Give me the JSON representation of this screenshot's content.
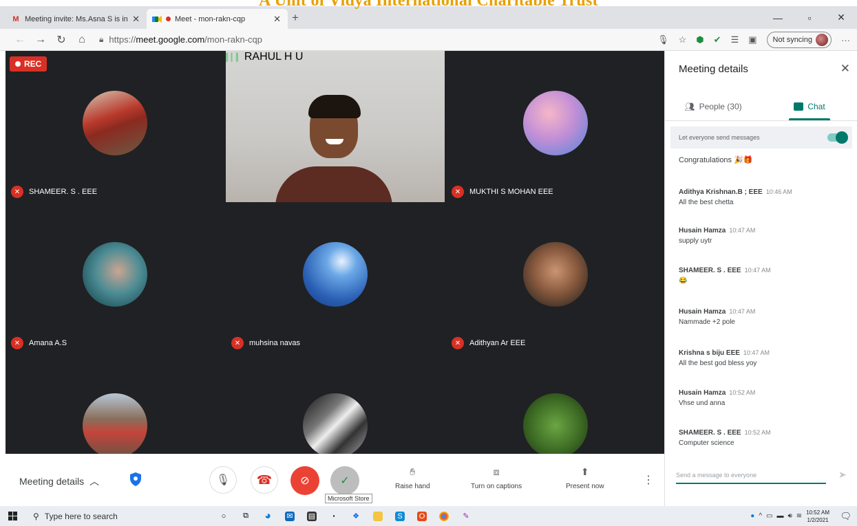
{
  "overlay_heading": "A Unit of Vidya International Charitable Trust",
  "browser": {
    "tabs": [
      {
        "title": "Meeting invite: Ms.Asna S is invi",
        "favicon": "gmail-icon",
        "active": false
      },
      {
        "title": "Meet - mon-rakn-cqp",
        "favicon": "meet-icon",
        "active": true,
        "recording": true
      }
    ],
    "url_prefix": "https://",
    "url_host": "meet.google.com",
    "url_path": "/mon-rakn-cqp",
    "sync_label": "Not syncing"
  },
  "meet": {
    "rec_label": "REC",
    "participants": [
      {
        "name": "SHAMEER. S . EEE",
        "muted": true,
        "avatar": "car-photo"
      },
      {
        "name": "RAHUL H U",
        "muted": false,
        "speaking": true,
        "video": true
      },
      {
        "name": "MUKTHI S MOHAN EEE",
        "muted": true,
        "avatar": "rose-photo"
      },
      {
        "name": "Amana A.S",
        "muted": true,
        "avatar": "girl-photo"
      },
      {
        "name": "muhsina navas",
        "muted": true,
        "avatar": "moon-sea-photo"
      },
      {
        "name": "Adithyan Ar EEE",
        "muted": true,
        "avatar": "actor-photo"
      },
      {
        "name": "",
        "muted": true,
        "avatar": "group-photo"
      },
      {
        "name": "",
        "muted": true,
        "avatar": "bw-photo"
      },
      {
        "name": "",
        "muted": true,
        "avatar": "leaf-photo"
      }
    ]
  },
  "controls": {
    "meeting_details": "Meeting details",
    "tooltip": "Microsoft Store",
    "raise_hand": "Raise hand",
    "captions": "Turn on captions",
    "present": "Present now"
  },
  "panel": {
    "title": "Meeting details",
    "people_tab": "People (30)",
    "chat_tab": "Chat",
    "everyone_label": "Let everyone send messages",
    "congrats": "Congratulations",
    "messages": [
      {
        "sender": "Adithya Krishnan.B ; EEE",
        "time": "10:46 AM",
        "text": "All the best chetta"
      },
      {
        "sender": "Husain Hamza",
        "time": "10:47 AM",
        "text": "supply uytr"
      },
      {
        "sender": "SHAMEER. S . EEE",
        "time": "10:47 AM",
        "text": "😂"
      },
      {
        "sender": "Husain Hamza",
        "time": "10:47 AM",
        "text": "Nammade +2 pole"
      },
      {
        "sender": "Krishna s biju EEE",
        "time": "10:47 AM",
        "text": "All the best god bless yoy"
      },
      {
        "sender": "Husain Hamza",
        "time": "10:52 AM",
        "text": "Vhse und anna"
      },
      {
        "sender": "SHAMEER. S . EEE",
        "time": "10:52 AM",
        "text": "Computer science"
      }
    ],
    "compose_placeholder": "Send a message to everyone"
  },
  "taskbar": {
    "search_placeholder": "Type here to search",
    "time": "10:52 AM",
    "date": "1/2/2021"
  }
}
